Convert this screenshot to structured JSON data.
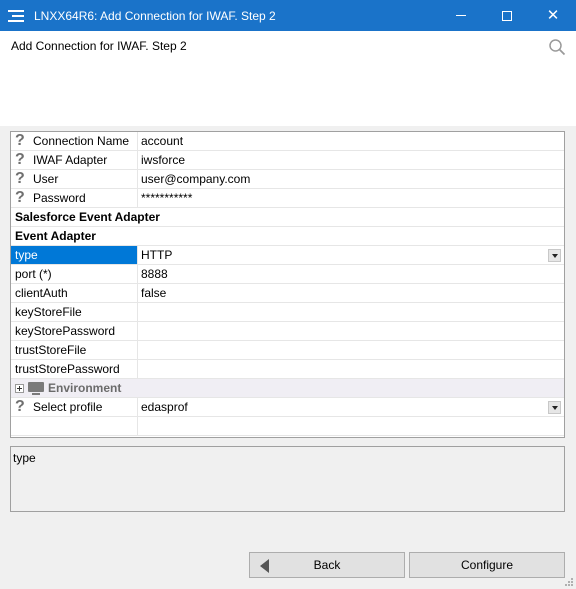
{
  "window": {
    "title": "LNXX64R6: Add Connection for IWAF. Step 2",
    "minimize_glyph": "",
    "close_glyph": "✕"
  },
  "header": {
    "step_title": "Add Connection for IWAF. Step 2"
  },
  "grid": {
    "rows": [
      {
        "kind": "help",
        "name": "Connection Name",
        "value": "account"
      },
      {
        "kind": "help",
        "name": "IWAF Adapter",
        "value": "iwsforce"
      },
      {
        "kind": "help",
        "name": "User",
        "value": "user@company.com"
      },
      {
        "kind": "help",
        "name": "Password",
        "value": "***********"
      },
      {
        "kind": "section",
        "name": "Salesforce Event Adapter"
      },
      {
        "kind": "section",
        "name": "Event Adapter"
      },
      {
        "kind": "selected",
        "name": "type",
        "value": "HTTP",
        "dropdown": true
      },
      {
        "kind": "plain",
        "name": "port (*)",
        "value": "8888"
      },
      {
        "kind": "plain",
        "name": "clientAuth",
        "value": "false"
      },
      {
        "kind": "plain",
        "name": "keyStoreFile",
        "value": ""
      },
      {
        "kind": "plain",
        "name": "keyStorePassword",
        "value": ""
      },
      {
        "kind": "plain",
        "name": "trustStoreFile",
        "value": ""
      },
      {
        "kind": "plain",
        "name": "trustStorePassword",
        "value": ""
      },
      {
        "kind": "group",
        "name": "Environment"
      },
      {
        "kind": "help",
        "name": "Select profile",
        "value": "edasprof",
        "dropdown": true
      },
      {
        "kind": "plain",
        "name": "",
        "value": ""
      }
    ],
    "help_glyph": "?"
  },
  "description": {
    "text": "type"
  },
  "buttons": {
    "back_label": "Back",
    "configure_label": "Configure"
  },
  "colors": {
    "titlebar": "#1a73c9",
    "selection": "#0078d7"
  }
}
